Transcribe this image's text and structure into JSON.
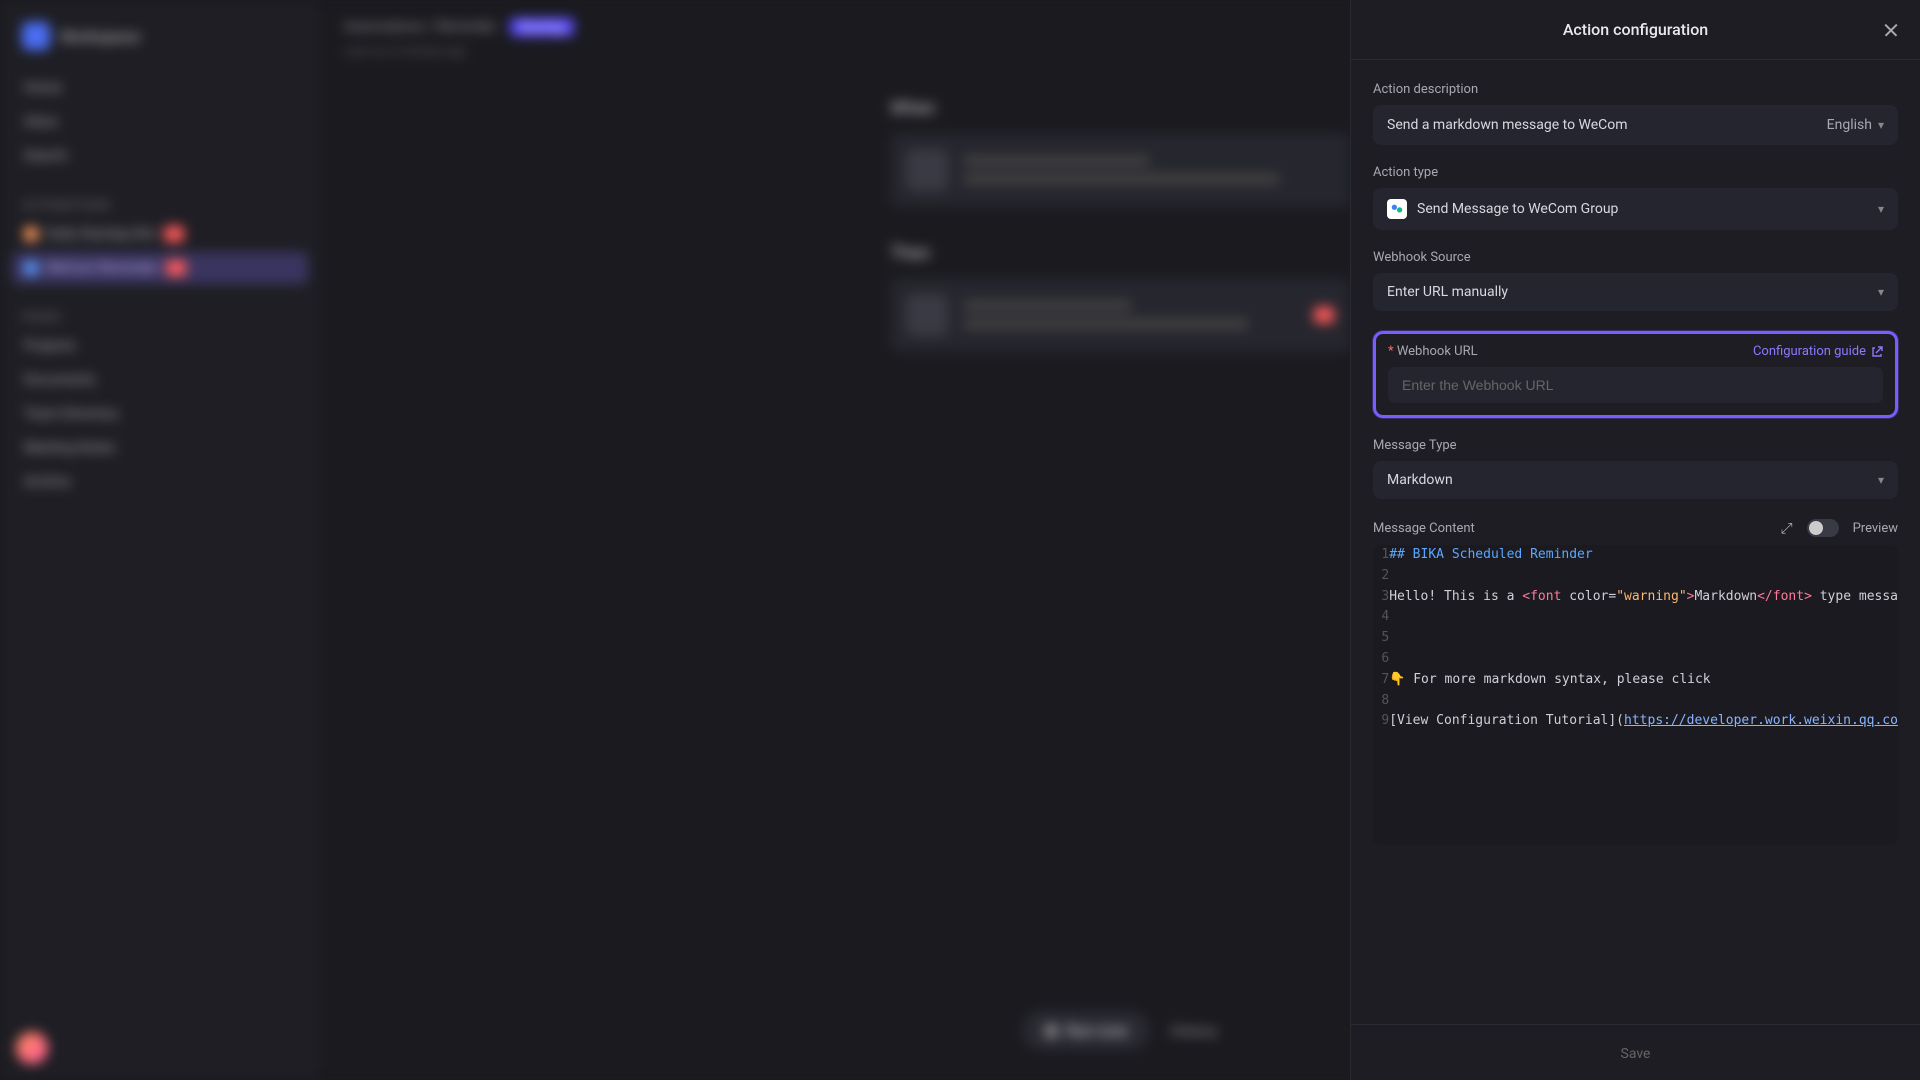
{
  "sidebar": {
    "workspace": "Workspace",
    "nav": [
      "Home",
      "Inbox",
      "Search"
    ],
    "section1_label": "Automations",
    "autos": [
      {
        "color": "#ff9a5a",
        "label": "Daily Standup Bot"
      },
      {
        "color": "#5a9aff",
        "label": "WeCom Reminder"
      }
    ],
    "section2_label": "Pages",
    "pages": [
      "Projects",
      "Documents",
      "Team Directory",
      "Meeting Notes",
      "Archive"
    ]
  },
  "breadcrumb": {
    "path": "Automations / Reminder",
    "badge": "Running",
    "sub": "Last run 3 minutes ago"
  },
  "content": {
    "when_label": "When",
    "then_label": "Then"
  },
  "footer": {
    "run": "Run now",
    "history": "History"
  },
  "panel": {
    "title": "Action configuration",
    "desc_label": "Action description",
    "desc_value": "Send a markdown message to WeCom",
    "lang": "English",
    "type_label": "Action type",
    "type_value": "Send Message to WeCom Group",
    "source_label": "Webhook Source",
    "source_value": "Enter URL manually",
    "url_label": "Webhook URL",
    "url_placeholder": "Enter the Webhook URL",
    "url_value": "",
    "config_guide": "Configuration guide",
    "msgtype_label": "Message Type",
    "msgtype_value": "Markdown",
    "content_label": "Message Content",
    "preview_label": "Preview",
    "save": "Save",
    "code_lines": [
      {
        "n": 1,
        "raw": "## BIKA Scheduled Reminder"
      },
      {
        "n": 2,
        "raw": ""
      },
      {
        "n": 3,
        "prefix": "Hello! This is a ",
        "tag_open": "<font ",
        "attr": "color=",
        "str": "\"warning\"",
        "tag_mid": ">",
        "inner": "Markdown",
        "tag_close": "</font>",
        "suffix": " type messa"
      },
      {
        "n": 4,
        "raw": ""
      },
      {
        "n": 5,
        "raw": ""
      },
      {
        "n": 6,
        "raw": ""
      },
      {
        "n": 7,
        "raw": "👇 For more markdown syntax, please click"
      },
      {
        "n": 8,
        "raw": ""
      },
      {
        "n": 9,
        "prefix": "[View Configuration Tutorial](",
        "url": "https://developer.work.weixin.qq.co"
      }
    ]
  }
}
